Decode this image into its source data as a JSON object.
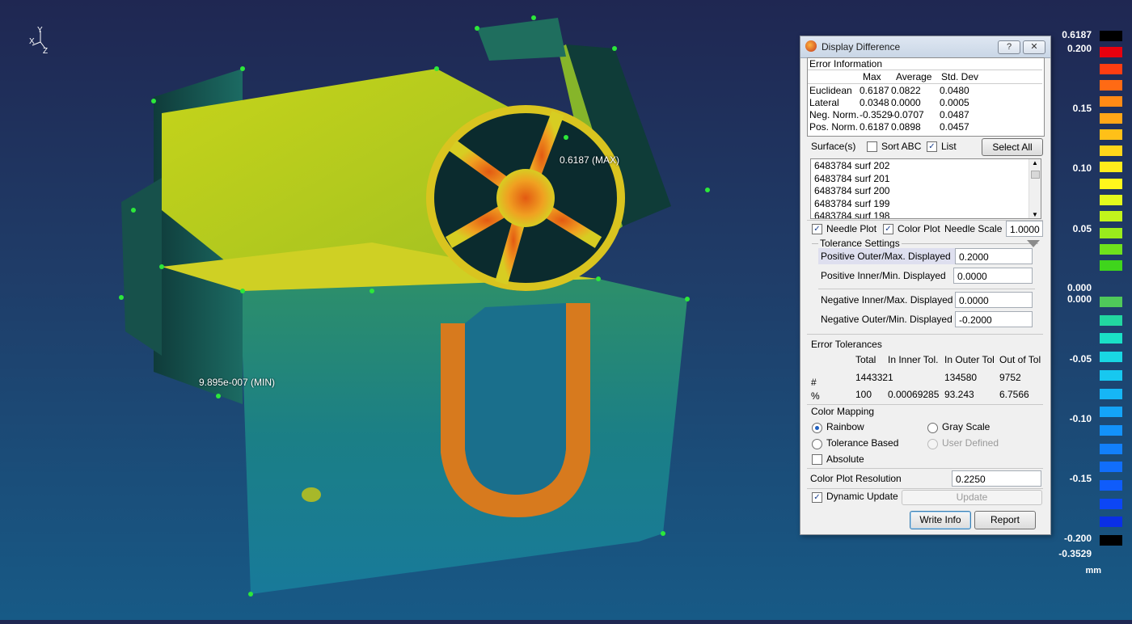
{
  "viewport": {
    "max_label": "0.6187 (MAX)",
    "min_label": "9.895e-007 (MIN)",
    "axis": {
      "x": "X",
      "y": "Y",
      "z": "Z"
    }
  },
  "dialog": {
    "title": "Display Difference",
    "help_btn": "?",
    "close_btn": "✕",
    "error_info": {
      "heading": "Error Information",
      "columns": [
        "",
        "Max",
        "Average",
        "Std. Dev"
      ],
      "rows": [
        [
          "Euclidean",
          "0.6187",
          "0.0822",
          "0.0480"
        ],
        [
          "Lateral",
          "0.0348",
          "0.0000",
          "0.0005"
        ],
        [
          "Neg. Norm.",
          "-0.3529",
          "-0.0707",
          "0.0487"
        ],
        [
          "Pos. Norm.",
          "0.6187",
          "0.0898",
          "0.0457"
        ]
      ]
    },
    "surfaces": {
      "label": "Surface(s)",
      "sort_abc": "Sort ABC",
      "list": "List",
      "select_all": "Select All",
      "items": [
        "6483784 surf 202",
        "6483784 surf 201",
        "6483784 surf 200",
        "6483784 surf 199",
        "6483784 surf 198"
      ]
    },
    "plot": {
      "needle_plot": "Needle Plot",
      "color_plot": "Color Plot",
      "needle_scale_label": "Needle Scale",
      "needle_scale_value": "1.0000"
    },
    "tolerance": {
      "heading": "Tolerance Settings",
      "pos_outer_label": "Positive Outer/Max. Displayed",
      "pos_outer_value": "0.2000",
      "pos_inner_label": "Positive Inner/Min. Displayed",
      "pos_inner_value": "0.0000",
      "neg_inner_label": "Negative Inner/Max. Displayed",
      "neg_inner_value": "0.0000",
      "neg_outer_label": "Negative Outer/Min. Displayed",
      "neg_outer_value": "-0.2000"
    },
    "error_tol": {
      "heading": "Error Tolerances",
      "columns": [
        "Total",
        "In Inner Tol.",
        "In Outer Tol",
        "Out of Tol"
      ],
      "row_count_label": "#",
      "row_pct_label": "%",
      "counts": [
        "144332",
        "1",
        "134580",
        "9752"
      ],
      "pcts": [
        "100",
        "0.00069285",
        "93.243",
        "6.7566"
      ]
    },
    "color_mapping": {
      "heading": "Color Mapping",
      "rainbow": "Rainbow",
      "gray_scale": "Gray Scale",
      "tolerance_based": "Tolerance Based",
      "user_defined": "User Defined",
      "absolute": "Absolute"
    },
    "resolution": {
      "label": "Color Plot Resolution",
      "value": "0.2250"
    },
    "dynamic_update": "Dynamic Update",
    "update_btn": "Update",
    "write_info": "Write Info",
    "report": "Report"
  },
  "colorbar": {
    "labels": {
      "top": "0.6187",
      "l200": "0.200",
      "l15": "0.15",
      "l10": "0.10",
      "l05": "0.05",
      "z1": "0.000",
      "z2": "0.000",
      "n05": "-0.05",
      "n10": "-0.10",
      "n15": "-0.15",
      "n200": "-0.200",
      "bottom": "-0.3529",
      "unit": "mm"
    },
    "colors_top": [
      "#000000",
      "#e8000e",
      "#ff3d12",
      "#ff6a14",
      "#ff8a15",
      "#ffa617",
      "#ffc018",
      "#ffd61a",
      "#ffec1c",
      "#fff71c",
      "#e3f91c",
      "#c2f41c",
      "#9aec1c",
      "#6fe11c",
      "#3fd51c"
    ],
    "colors_bottom": [
      "#4fc95a",
      "#22d6a0",
      "#1ae0c6",
      "#19d7e3",
      "#17c8f0",
      "#16b6f6",
      "#14a4f8",
      "#1392fa",
      "#1280fb",
      "#116efb",
      "#0f5cfb",
      "#0c46f5",
      "#0a2fe6",
      "#000000"
    ]
  }
}
